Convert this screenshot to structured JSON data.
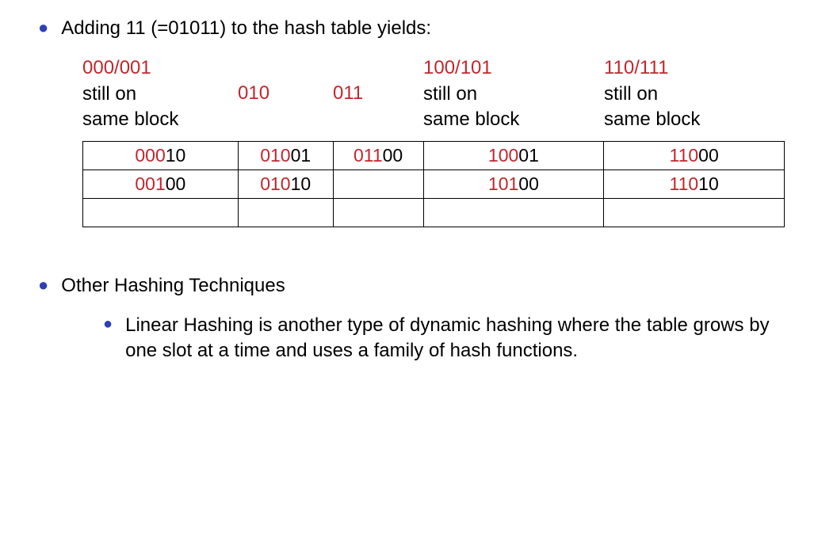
{
  "bullet1": "Adding 11 (=01011) to the hash table yields:",
  "headers": {
    "c0": {
      "line1": "000/001",
      "l2a": "still",
      "l2b": "on",
      "line3": "same block"
    },
    "c1": "010",
    "c2": "011",
    "c3": {
      "line1": "100/101",
      "l2a": "still",
      "l2b": "on",
      "line3": "same block"
    },
    "c4": {
      "line1": "110/111",
      "l2a": "still",
      "l2b": "on",
      "line3": "same block"
    }
  },
  "table": {
    "r0": {
      "c0": {
        "pre": "000",
        "rest": "10"
      },
      "c1": {
        "pre": "010",
        "rest": "01"
      },
      "c2": {
        "pre": "011",
        "rest": "00"
      },
      "c3": {
        "pre": "100",
        "rest": "01"
      },
      "c4": {
        "pre": "110",
        "rest": "00"
      }
    },
    "r1": {
      "c0": {
        "pre": "001",
        "rest": "00"
      },
      "c1": {
        "pre": "010",
        "rest": "10"
      },
      "c2": {
        "pre": "",
        "rest": ""
      },
      "c3": {
        "pre": "101",
        "rest": "00"
      },
      "c4": {
        "pre": "110",
        "rest": "10"
      }
    }
  },
  "bullet2": "Other Hashing Techniques",
  "sub1": "Linear Hashing is another type of dynamic hashing where the table grows by one slot at a time and uses a family of hash functions."
}
